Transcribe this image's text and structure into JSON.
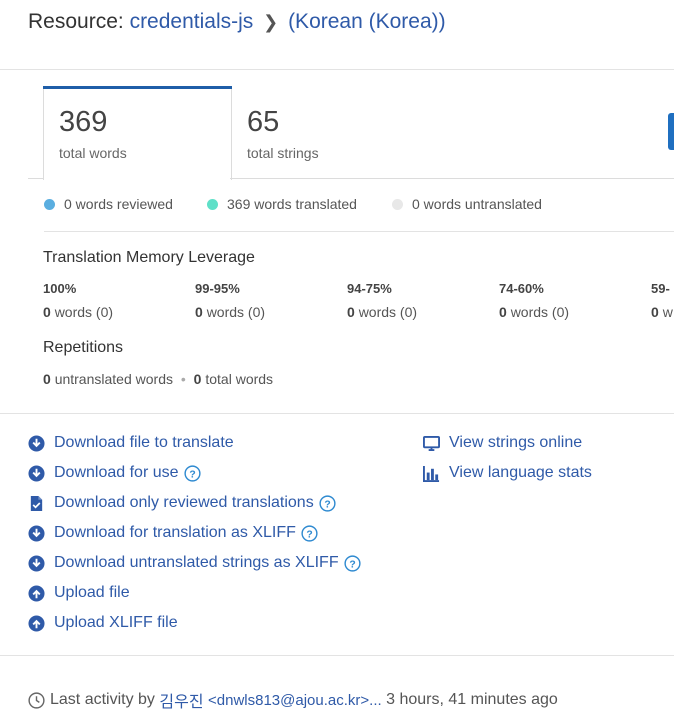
{
  "header": {
    "prefix": "Resource:",
    "resource": "credentials-js",
    "language": "(Korean (Korea))"
  },
  "tabs": [
    {
      "value": "369",
      "label": "total words",
      "active": true
    },
    {
      "value": "65",
      "label": "total strings",
      "active": false
    }
  ],
  "legend": [
    {
      "text": "0 words reviewed",
      "color": "#5aaee0"
    },
    {
      "text": "369 words translated",
      "color": "#5fe0c8"
    },
    {
      "text": "0 words untranslated",
      "color": "#e8e8e8"
    }
  ],
  "tm": {
    "title": "Translation Memory Leverage",
    "columns": [
      {
        "pct": "100%",
        "count": "0",
        "rest": "words (0)"
      },
      {
        "pct": "99-95%",
        "count": "0",
        "rest": "words (0)"
      },
      {
        "pct": "94-75%",
        "count": "0",
        "rest": "words (0)"
      },
      {
        "pct": "74-60%",
        "count": "0",
        "rest": "words (0)"
      },
      {
        "pct": "59-",
        "count": "0",
        "rest": "w"
      }
    ]
  },
  "repetitions": {
    "title": "Repetitions",
    "untranslated_count": "0",
    "untranslated_label": "untranslated words",
    "bullet": "•",
    "total_count": "0",
    "total_label": "total words"
  },
  "links_left": [
    {
      "label": "Download file to translate",
      "icon": "download-circle-icon",
      "help": false
    },
    {
      "label": "Download for use",
      "icon": "download-circle-icon",
      "help": true
    },
    {
      "label": "Download only reviewed translations",
      "icon": "file-check-icon",
      "help": true
    },
    {
      "label": "Download for translation as XLIFF",
      "icon": "download-circle-icon",
      "help": true
    },
    {
      "label": "Download untranslated strings as XLIFF",
      "icon": "download-circle-icon",
      "help": true
    },
    {
      "label": "Upload file",
      "icon": "upload-circle-icon",
      "help": false
    },
    {
      "label": "Upload XLIFF file",
      "icon": "upload-circle-icon",
      "help": false
    }
  ],
  "links_right": [
    {
      "label": "View strings online",
      "icon": "monitor-icon"
    },
    {
      "label": "View language stats",
      "icon": "bar-chart-icon"
    }
  ],
  "footer": {
    "prefix": "Last activity by",
    "user": "김우진",
    "email": "<dnwls813@ajou.ac.kr>...",
    "time": "3 hours, 41 minutes ago"
  },
  "colors": {
    "link": "#2f5aa8",
    "accent": "#1f5ea8"
  }
}
